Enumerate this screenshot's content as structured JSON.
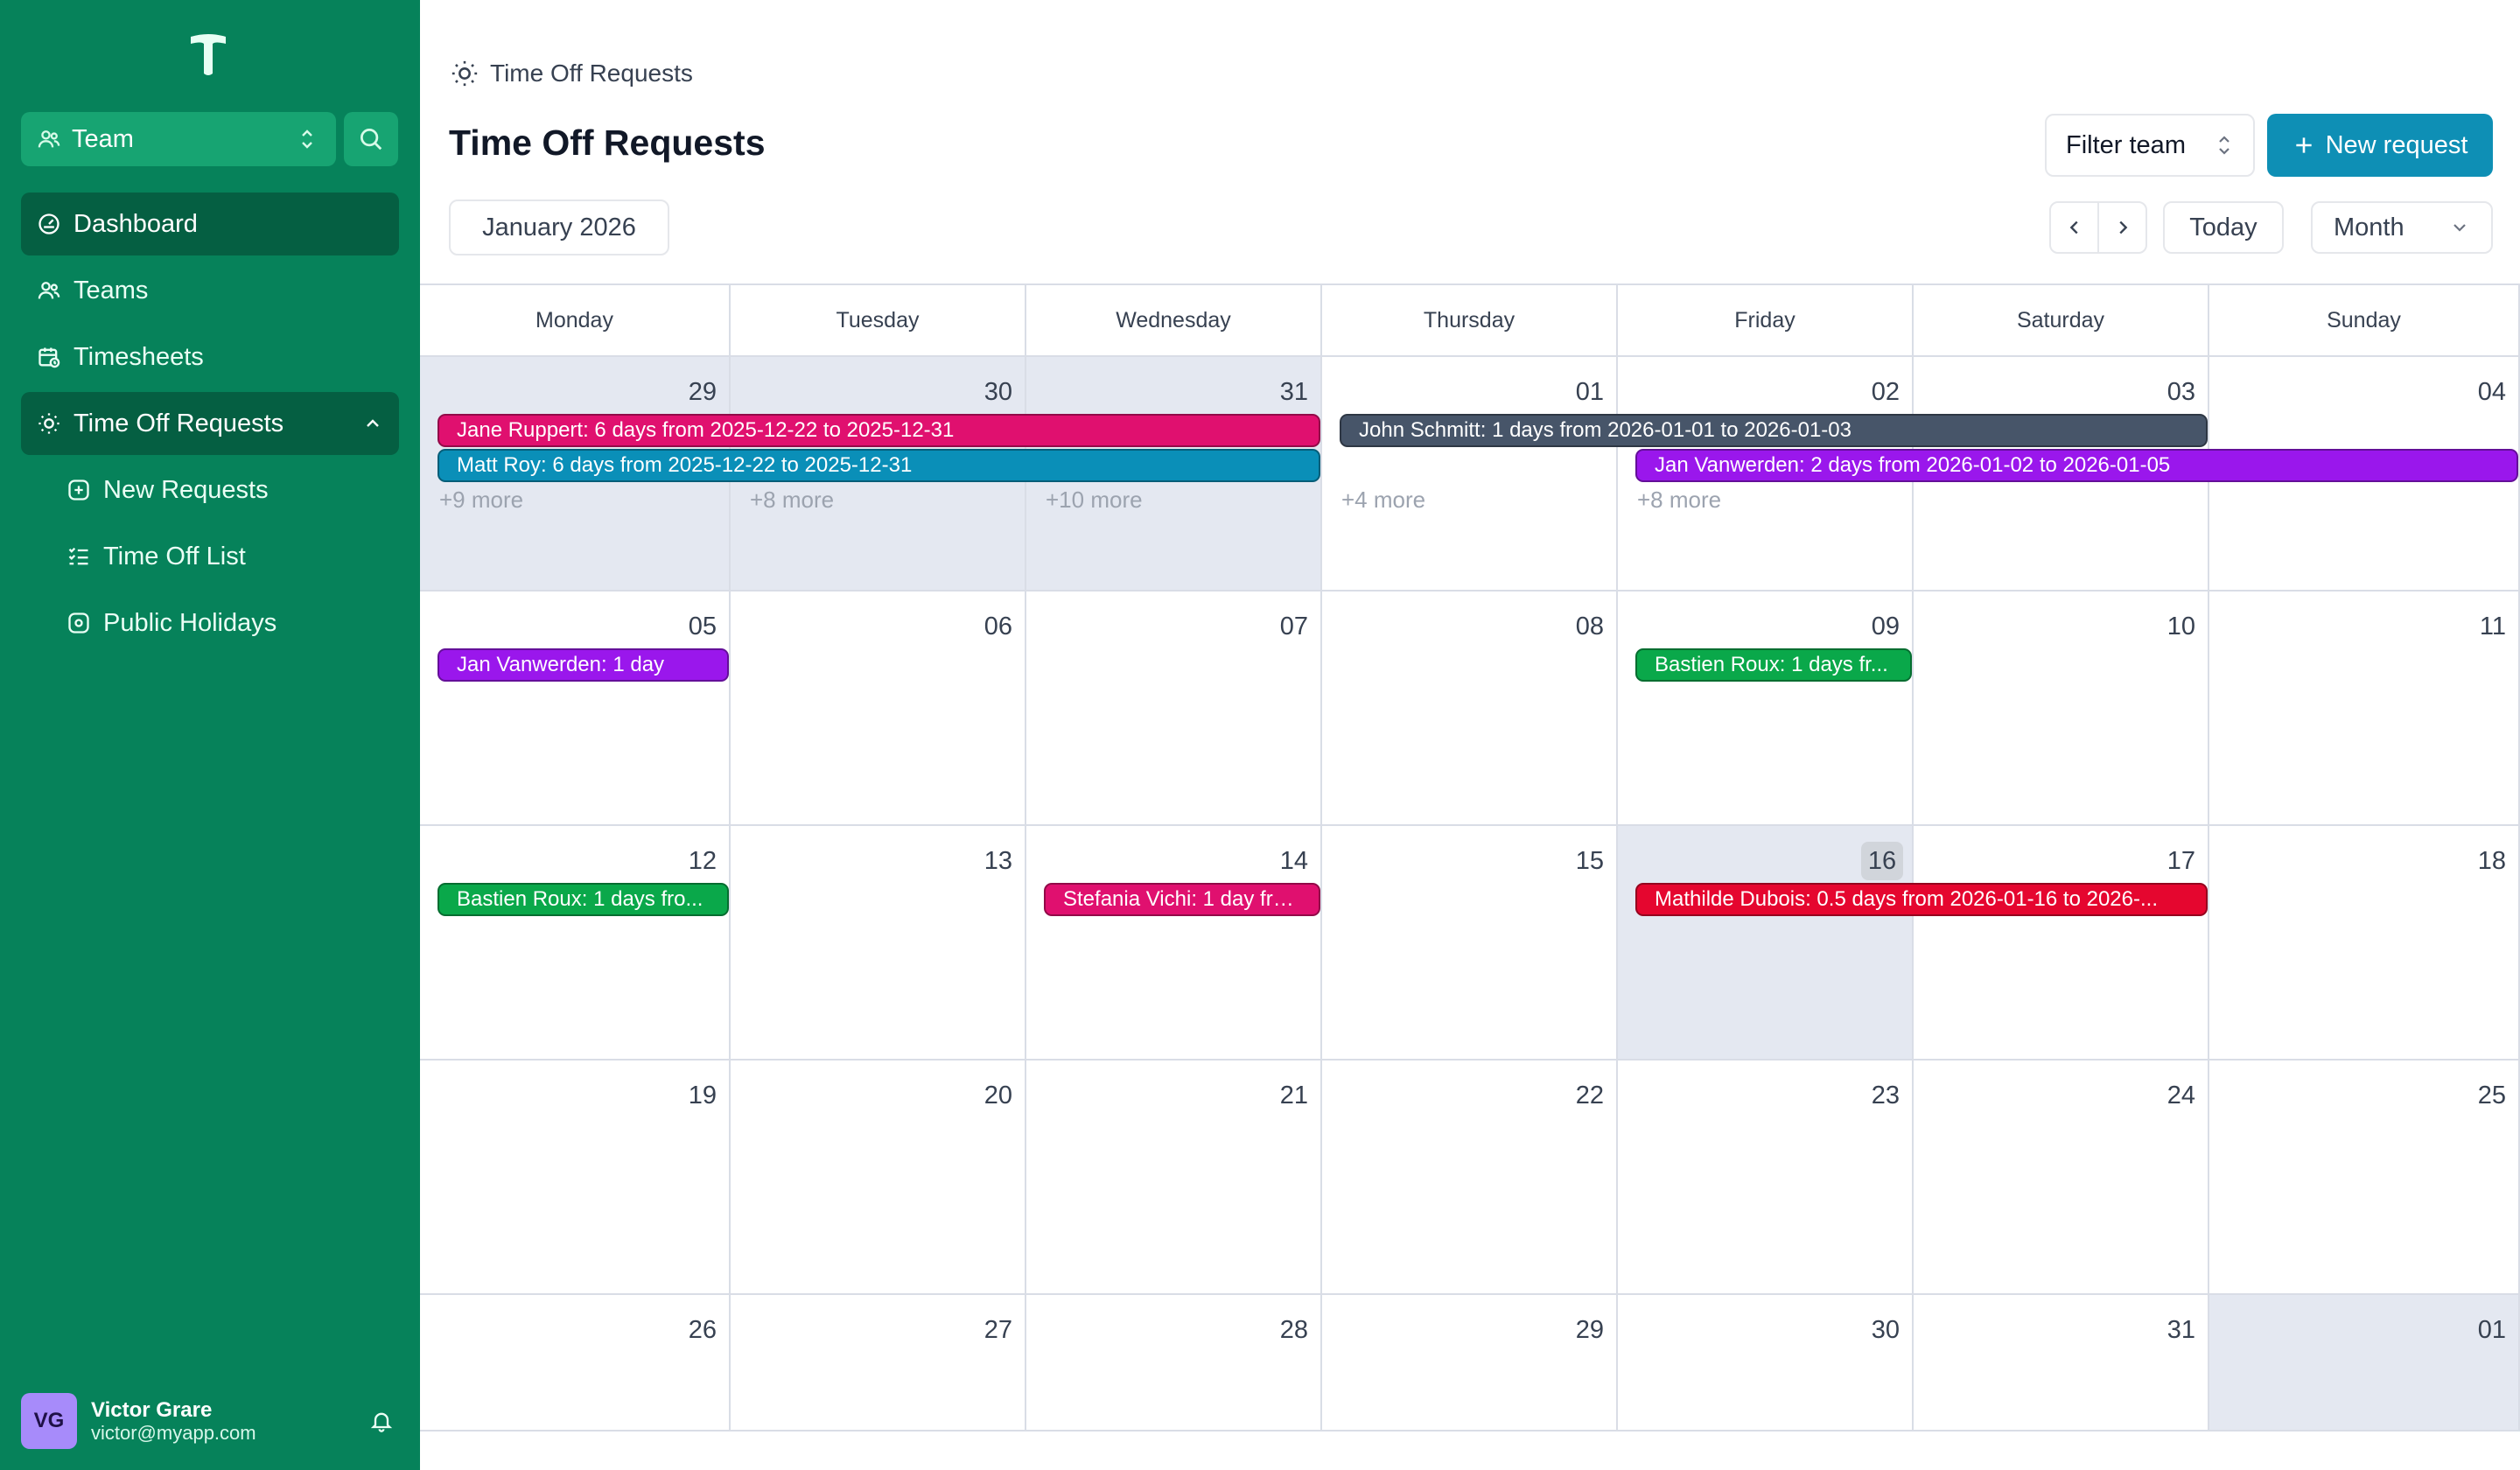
{
  "app": {
    "team_select_label": "Team"
  },
  "sidebar": {
    "items": [
      {
        "label": "Dashboard"
      },
      {
        "label": "Teams"
      },
      {
        "label": "Timesheets"
      },
      {
        "label": "Time Off Requests"
      }
    ],
    "subitems": [
      {
        "label": "New Requests"
      },
      {
        "label": "Time Off List"
      },
      {
        "label": "Public Holidays"
      }
    ]
  },
  "user": {
    "initials": "VG",
    "name": "Victor Grare",
    "email": "victor@myapp.com"
  },
  "header": {
    "breadcrumb": "Time Off Requests",
    "title": "Time Off Requests",
    "filter_label": "Filter team",
    "new_request_label": "New request"
  },
  "toolbar": {
    "month_label": "January 2026",
    "today_label": "Today",
    "view_label": "Month"
  },
  "calendar": {
    "weekdays": [
      "Monday",
      "Tuesday",
      "Wednesday",
      "Thursday",
      "Friday",
      "Saturday",
      "Sunday"
    ],
    "weeks": [
      [
        "29",
        "30",
        "31",
        "01",
        "02",
        "03",
        "04"
      ],
      [
        "05",
        "06",
        "07",
        "08",
        "09",
        "10",
        "11"
      ],
      [
        "12",
        "13",
        "14",
        "15",
        "16",
        "17",
        "18"
      ],
      [
        "19",
        "20",
        "21",
        "22",
        "23",
        "24",
        "25"
      ],
      [
        "26",
        "27",
        "28",
        "29",
        "30",
        "31",
        "01"
      ]
    ],
    "today": {
      "week": 2,
      "day": 4
    },
    "events": [
      {
        "week": 0,
        "start": 0,
        "span": 3,
        "lane": 0,
        "text": "Jane Ruppert: 6 days from 2025-12-22 to 2025-12-31",
        "color": "#e0106f"
      },
      {
        "week": 0,
        "start": 0,
        "span": 3,
        "lane": 1,
        "text": "Matt Roy: 6 days from 2025-12-22 to 2025-12-31",
        "color": "#0a8fb8"
      },
      {
        "week": 0,
        "start": 3,
        "span": 3,
        "lane": 0,
        "text": "John Schmitt: 1 days from 2026-01-01 to 2026-01-03",
        "color": "#475569"
      },
      {
        "week": 0,
        "start": 4,
        "span": 3,
        "lane": 1,
        "text": "Jan Vanwerden: 2 days from 2026-01-02 to 2026-01-05",
        "color": "#9a17ec"
      },
      {
        "week": 1,
        "start": 0,
        "span": 1,
        "lane": 0,
        "text": "Jan Vanwerden: 1 day",
        "color": "#9a17ec"
      },
      {
        "week": 1,
        "start": 4,
        "span": 1,
        "lane": 0,
        "text": "Bastien Roux: 1 days fr...",
        "color": "#0aa84a"
      },
      {
        "week": 2,
        "start": 0,
        "span": 1,
        "lane": 0,
        "text": "Bastien Roux: 1 days fro...",
        "color": "#0aa84a"
      },
      {
        "week": 2,
        "start": 2,
        "span": 1,
        "lane": 0,
        "text": "Stefania Vichi: 1 day fro...",
        "color": "#e0106f"
      },
      {
        "week": 2,
        "start": 4,
        "span": 2,
        "lane": 0,
        "text": "Mathilde Dubois: 0.5 days from 2026-01-16 to 2026-...",
        "color": "#e5062f"
      }
    ],
    "more": [
      {
        "week": 0,
        "day": 0,
        "text": "+9 more"
      },
      {
        "week": 0,
        "day": 1,
        "text": "+8 more"
      },
      {
        "week": 0,
        "day": 2,
        "text": "+10 more"
      },
      {
        "week": 0,
        "day": 3,
        "text": "+4 more"
      },
      {
        "week": 0,
        "day": 4,
        "text": "+8 more"
      }
    ]
  }
}
